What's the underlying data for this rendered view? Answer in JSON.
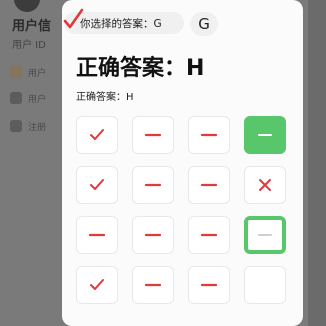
{
  "background": {
    "title": "用户信",
    "subtitle": "用户 ID",
    "rows": [
      "用户",
      "用户",
      "注册"
    ]
  },
  "chip": {
    "label": "你选择的答案：G"
  },
  "pill": {
    "label": "G"
  },
  "heading": "正确答案：H",
  "answer_line": "正确答案：H",
  "grid": [
    [
      "check",
      "dash",
      "dash",
      "dash-green-filled"
    ],
    [
      "check",
      "dash",
      "dash",
      "cross"
    ],
    [
      "dash",
      "dash",
      "dash",
      "dash-green-outline"
    ],
    [
      "check",
      "dash",
      "dash",
      "empty"
    ]
  ],
  "colors": {
    "red": "#e0393e",
    "green": "#58c66b"
  }
}
